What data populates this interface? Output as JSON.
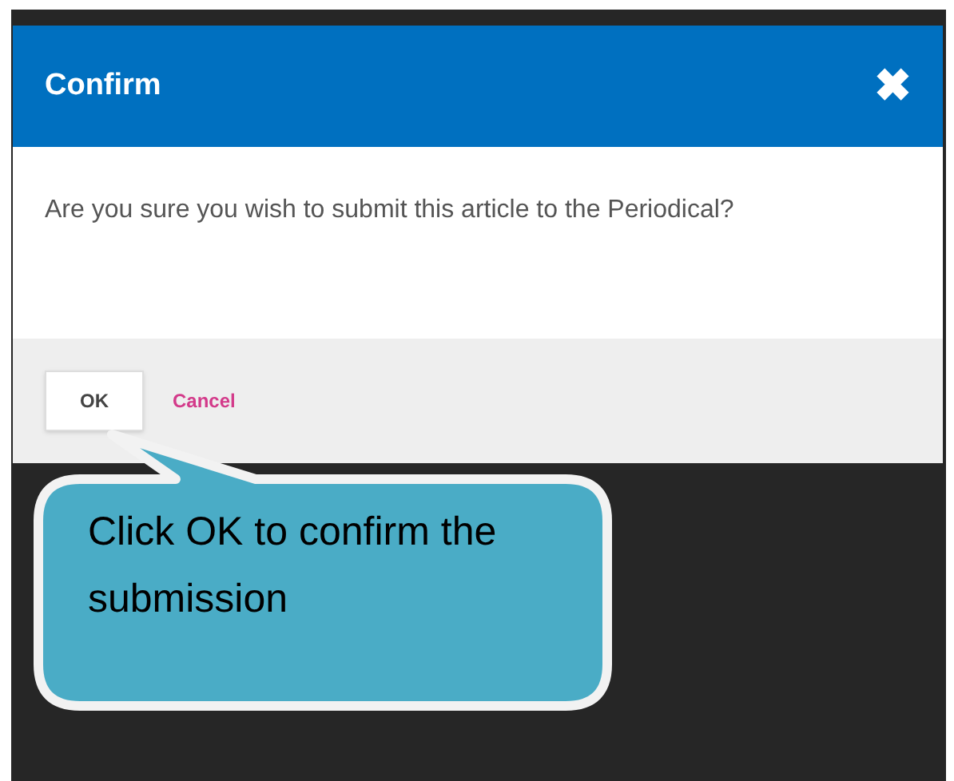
{
  "dialog": {
    "title": "Confirm",
    "close": "✖",
    "message": "Are you sure you wish to submit this article to the Periodical?",
    "buttons": [
      {
        "label": "OK",
        "kind": "primary"
      },
      {
        "label": "Cancel",
        "kind": "link"
      }
    ]
  },
  "callout": {
    "text": "Click OK to confirm the submission"
  }
}
